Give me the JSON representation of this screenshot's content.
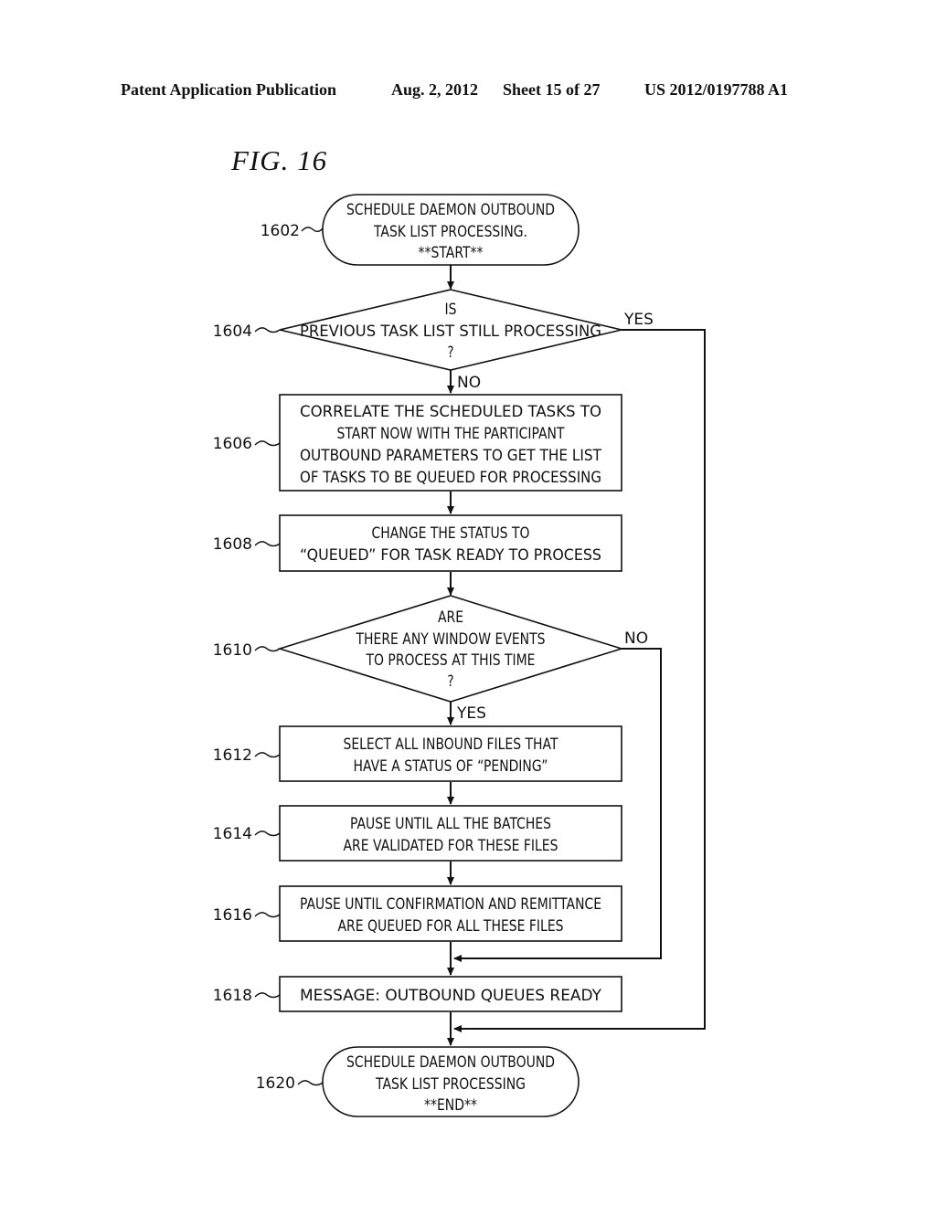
{
  "header": {
    "publication": "Patent Application Publication",
    "date": "Aug. 2, 2012",
    "sheet": "Sheet 15 of 27",
    "number": "US 2012/0197788 A1"
  },
  "figure": {
    "title": "FIG.  16"
  },
  "nodes": {
    "n1602": {
      "ref": "1602",
      "type": "terminal",
      "lines": [
        "SCHEDULE DAEMON OUTBOUND",
        "TASK LIST PROCESSING.",
        "**START**"
      ]
    },
    "n1604": {
      "ref": "1604",
      "type": "decision",
      "lines": [
        "IS",
        "PREVIOUS TASK LIST STILL PROCESSING",
        "?"
      ]
    },
    "n1606": {
      "ref": "1606",
      "type": "process",
      "lines": [
        "CORRELATE THE SCHEDULED TASKS TO",
        "START NOW WITH THE PARTICIPANT",
        "OUTBOUND PARAMETERS TO GET THE LIST",
        "OF TASKS TO BE QUEUED FOR PROCESSING"
      ]
    },
    "n1608": {
      "ref": "1608",
      "type": "process",
      "lines": [
        "CHANGE THE STATUS TO",
        "“QUEUED” FOR TASK READY TO PROCESS"
      ]
    },
    "n1610": {
      "ref": "1610",
      "type": "decision",
      "lines": [
        "ARE",
        "THERE ANY WINDOW EVENTS",
        "TO PROCESS AT THIS TIME",
        "?"
      ]
    },
    "n1612": {
      "ref": "1612",
      "type": "process",
      "lines": [
        "SELECT ALL INBOUND FILES THAT",
        "HAVE A STATUS OF “PENDING”"
      ]
    },
    "n1614": {
      "ref": "1614",
      "type": "process",
      "lines": [
        "PAUSE UNTIL ALL THE BATCHES",
        "ARE VALIDATED FOR THESE FILES"
      ]
    },
    "n1616": {
      "ref": "1616",
      "type": "process",
      "lines": [
        "PAUSE UNTIL CONFIRMATION AND REMITTANCE",
        "ARE QUEUED FOR ALL THESE FILES"
      ]
    },
    "n1618": {
      "ref": "1618",
      "type": "process",
      "lines": [
        "MESSAGE: OUTBOUND QUEUES READY"
      ]
    },
    "n1620": {
      "ref": "1620",
      "type": "terminal",
      "lines": [
        "SCHEDULE DAEMON OUTBOUND",
        "TASK LIST PROCESSING",
        "**END**"
      ]
    }
  },
  "edges": {
    "e1604_yes": {
      "from": "1604",
      "to": "1620",
      "label": "YES"
    },
    "e1604_no": {
      "from": "1604",
      "to": "1606",
      "label": "NO"
    },
    "e1610_yes": {
      "from": "1610",
      "to": "1612",
      "label": "YES"
    },
    "e1610_no": {
      "from": "1610",
      "to": "1618",
      "label": "NO"
    }
  }
}
